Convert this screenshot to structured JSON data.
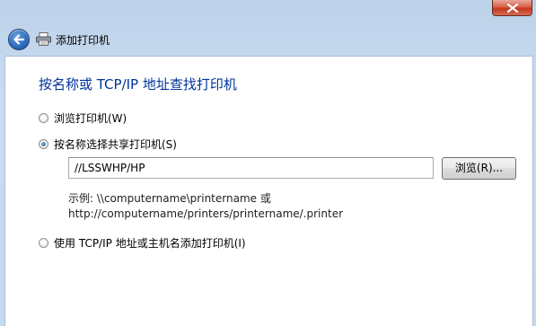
{
  "window": {
    "title": "添加打印机",
    "close_icon": "close-icon",
    "back_icon": "back-arrow-icon",
    "app_icon": "printer-icon"
  },
  "content": {
    "heading": "按名称或 TCP/IP 地址查找打印机",
    "options": [
      {
        "label": "浏览打印机(W)",
        "checked": false
      },
      {
        "label": "按名称选择共享打印机(S)",
        "checked": true
      },
      {
        "label": "使用 TCP/IP 地址或主机名添加打印机(I)",
        "checked": false
      }
    ],
    "printer_path": {
      "value": "//LSSWHP/HP"
    },
    "browse_button": "浏览(R)...",
    "example_line1": "示例: \\\\computername\\printername 或",
    "example_line2": "http://computername/printers/printername/.printer"
  },
  "colors": {
    "heading": "#003399",
    "frame": "#c9dcef",
    "close_button": "#c2391f"
  }
}
